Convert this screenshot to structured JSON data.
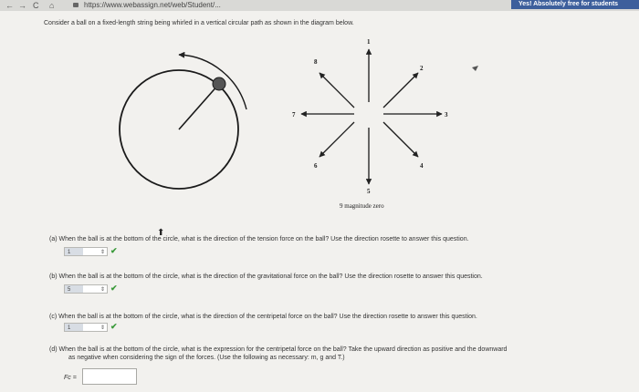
{
  "browser": {
    "nav_back": "←",
    "nav_forward": "→",
    "nav_reload": "C",
    "nav_home": "⌂",
    "url": "https://www.webassign.net/web/Student/...",
    "banner": "Yes! Absolutely free for students"
  },
  "problem": {
    "prompt": "Consider a ball on a fixed-length string being whirled in a vertical circular path as shown in the diagram below.",
    "rosette": {
      "labels": [
        "1",
        "2",
        "3",
        "4",
        "5",
        "6",
        "7",
        "8"
      ],
      "zero_label": "9 magnitude zero"
    },
    "questions": [
      {
        "tag": "(a)",
        "text": "When the ball is at the bottom of the circle, what is the direction of the tension force on the ball? Use the direction rosette to answer this question.",
        "answer": "1",
        "correct": "✔"
      },
      {
        "tag": "(b)",
        "text": "When the ball is at the bottom of the circle, what is the direction of the gravitational force on the ball? Use the direction rosette to answer this question.",
        "answer": "5",
        "correct": "✔"
      },
      {
        "tag": "(c)",
        "text": "When the ball is at the bottom of the circle, what is the direction of the centripetal force on the ball? Use the direction rosette to answer this question.",
        "answer": "1",
        "correct": "✔"
      },
      {
        "tag": "(d)",
        "text": "When the ball is at the bottom of the circle, what is the expression for the centripetal force on the ball? Take the upward direction as positive and the downward",
        "text2": "as negative when considering the sign of the forces. (Use the following as necessary: m, g and T.)"
      }
    ],
    "fc_label": "Fc =",
    "fc_value": ""
  }
}
